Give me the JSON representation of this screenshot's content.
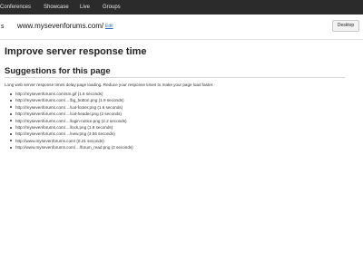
{
  "topnav": {
    "items": [
      "Conferences",
      "Showcase",
      "Live",
      "Groups"
    ]
  },
  "urlbar": {
    "logo_text": "S",
    "logo_sub": "...",
    "url": "www.mysevenforums.com/",
    "edit_label": "Edit",
    "desktop_button": "Desktop"
  },
  "main": {
    "title": "Improve server response time",
    "section_title": "Suggestions for this page",
    "intro": "Long web server response times delay page loading. Reduce your response times to make your page load faster.",
    "resources": [
      "http://mysevenforums.com/sm.gif (1.6 seconds)",
      "http://mysevenforums.com/…/bg_button.png (1.9 seconds)",
      "http://mysevenforums.com/…/cat-footer.png (1.6 seconds)",
      "http://mysevenforums.com/…/cat-header.png (2 seconds)",
      "http://mysevenforums.com/…/login-notice.png (2.2 seconds)",
      "http://mysevenforums.com/…/lock.png (1.9 seconds)",
      "http://mysevenforums.com/…/new.png (3.56 seconds)",
      "http://www.mysevenforums.com/ (0.21 seconds)",
      "http://www.mysevenforums.com/…/forum_read.png (2 seconds)"
    ]
  }
}
